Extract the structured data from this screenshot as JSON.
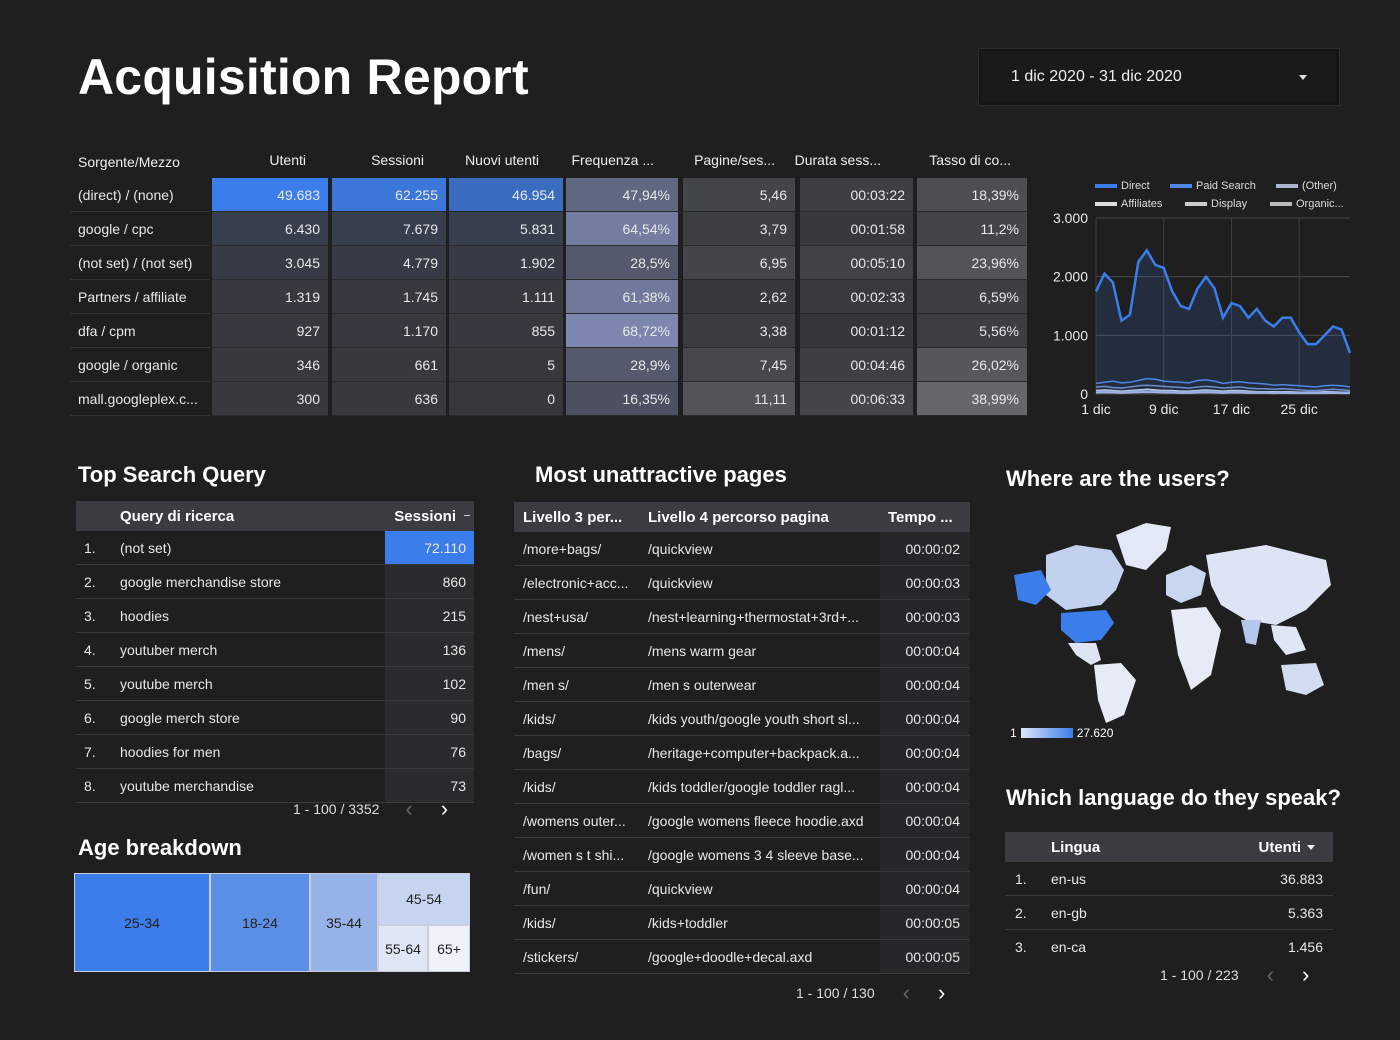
{
  "title": "Acquisition Report",
  "date_range": "1 dic 2020 - 31 dic 2020",
  "colors": {
    "accent": "#3b7dea",
    "background": "#1f1f1f",
    "header_bg": "#3a3c42"
  },
  "main_table": {
    "headers": [
      "Sorgente/Mezzo",
      "Utenti",
      "Sessioni",
      "Nuovi utenti",
      "Frequenza ...",
      "Pagine/ses...",
      "Durata sess...",
      "Tasso di co..."
    ],
    "rows": [
      [
        "(direct) / (none)",
        "49.683",
        "62.255",
        "46.954",
        "47,94%",
        "5,46",
        "00:03:22",
        "18,39%"
      ],
      [
        "google / cpc",
        "6.430",
        "7.679",
        "5.831",
        "64,54%",
        "3,79",
        "00:01:58",
        "11,2%"
      ],
      [
        "(not set) / (not set)",
        "3.045",
        "4.779",
        "1.902",
        "28,5%",
        "6,95",
        "00:05:10",
        "23,96%"
      ],
      [
        "Partners / affiliate",
        "1.319",
        "1.745",
        "1.111",
        "61,38%",
        "2,62",
        "00:02:33",
        "6,59%"
      ],
      [
        "dfa / cpm",
        "927",
        "1.170",
        "855",
        "68,72%",
        "3,38",
        "00:01:12",
        "5,56%"
      ],
      [
        "google / organic",
        "346",
        "661",
        "5",
        "28,9%",
        "7,45",
        "00:04:46",
        "26,02%"
      ],
      [
        "mall.googleplex.c...",
        "300",
        "636",
        "0",
        "16,35%",
        "11,11",
        "00:06:33",
        "38,99%"
      ]
    ],
    "heat": [
      [
        1.0,
        0.9,
        0.75,
        0.45,
        0.3,
        0.2,
        0.45
      ],
      [
        0.1,
        0.1,
        0.1,
        0.7,
        0.2,
        0.1,
        0.3
      ],
      [
        0.05,
        0.05,
        0.05,
        0.3,
        0.3,
        0.25,
        0.55
      ],
      [
        0.02,
        0.02,
        0.02,
        0.65,
        0.1,
        0.12,
        0.2
      ],
      [
        0.02,
        0.02,
        0.02,
        0.8,
        0.15,
        0.05,
        0.18
      ],
      [
        0.01,
        0.01,
        0.0,
        0.3,
        0.35,
        0.22,
        0.6
      ],
      [
        0.01,
        0.01,
        0.0,
        0.2,
        0.55,
        0.3,
        0.85
      ]
    ]
  },
  "chart_data": {
    "type": "line",
    "legend": [
      "Direct",
      "Paid Search",
      "(Other)",
      "Affiliates",
      "Display",
      "Organic..."
    ],
    "x_ticks": [
      "1 dic",
      "9 dic",
      "17 dic",
      "25 dic"
    ],
    "y_ticks": [
      "3.000",
      "2.000",
      "1.000",
      "0"
    ],
    "ylim": [
      0,
      3000
    ],
    "x": [
      1,
      2,
      3,
      4,
      5,
      6,
      7,
      8,
      9,
      10,
      11,
      12,
      13,
      14,
      15,
      16,
      17,
      18,
      19,
      20,
      21,
      22,
      23,
      24,
      25,
      26,
      27,
      28,
      29,
      30,
      31
    ],
    "series": [
      {
        "name": "Direct",
        "color": "#3b7dea",
        "values": [
          1750,
          2050,
          1900,
          1250,
          1350,
          2250,
          2450,
          2200,
          2150,
          1750,
          1500,
          1450,
          1800,
          2000,
          1800,
          1300,
          1550,
          1500,
          1300,
          1450,
          1250,
          1150,
          1300,
          1300,
          1050,
          850,
          850,
          1000,
          1150,
          1100,
          700
        ]
      },
      {
        "name": "Paid Search",
        "color": "#4f86e8",
        "values": [
          180,
          200,
          220,
          190,
          200,
          230,
          260,
          250,
          220,
          210,
          200,
          190,
          230,
          240,
          220,
          180,
          200,
          210,
          190,
          180,
          170,
          150,
          160,
          150,
          140,
          130,
          120,
          140,
          150,
          140,
          120
        ]
      },
      {
        "name": "(Other)",
        "color": "#6f8fd0",
        "values": [
          120,
          130,
          110,
          100,
          120,
          140,
          150,
          140,
          130,
          120,
          110,
          100,
          120,
          130,
          120,
          100,
          110,
          120,
          100,
          90,
          90,
          80,
          90,
          80,
          70,
          60,
          60,
          70,
          80,
          70,
          60
        ]
      },
      {
        "name": "Affiliates",
        "color": "#b8c6e8",
        "values": [
          60,
          70,
          60,
          50,
          60,
          70,
          80,
          70,
          60,
          60,
          50,
          50,
          60,
          70,
          60,
          50,
          60,
          60,
          50,
          40,
          40,
          40,
          40,
          40,
          30,
          30,
          30,
          40,
          40,
          30,
          30
        ]
      },
      {
        "name": "Display",
        "color": "#8fa8dc",
        "values": [
          40,
          50,
          40,
          30,
          40,
          50,
          50,
          50,
          40,
          40,
          30,
          30,
          40,
          50,
          40,
          30,
          40,
          40,
          30,
          30,
          30,
          20,
          30,
          20,
          20,
          20,
          20,
          20,
          30,
          20,
          20
        ]
      },
      {
        "name": "Organic...",
        "color": "#a0b4e0",
        "values": [
          20,
          25,
          20,
          15,
          20,
          25,
          30,
          25,
          20,
          20,
          15,
          15,
          20,
          25,
          20,
          15,
          20,
          20,
          15,
          15,
          15,
          10,
          15,
          10,
          10,
          10,
          10,
          10,
          15,
          10,
          10
        ]
      }
    ]
  },
  "search_query": {
    "title": "Top Search Query",
    "headers": [
      "Query di ricerca",
      "Sessioni"
    ],
    "rows": [
      [
        "1.",
        "(not set)",
        "72.110"
      ],
      [
        "2.",
        "google merchandise store",
        "860"
      ],
      [
        "3.",
        "hoodies",
        "215"
      ],
      [
        "4.",
        "youtuber merch",
        "136"
      ],
      [
        "5.",
        "youtube merch",
        "102"
      ],
      [
        "6.",
        "google merch store",
        "90"
      ],
      [
        "7.",
        "hoodies for men",
        "76"
      ],
      [
        "8.",
        "youtube merchandise",
        "73"
      ]
    ],
    "pager": "1 - 100 / 3352"
  },
  "pages": {
    "title": "Most unattractive pages",
    "headers": [
      "Livello 3 per...",
      "Livello 4 percorso pagina",
      "Tempo ..."
    ],
    "rows": [
      [
        "/more+bags/",
        "/quickview",
        "00:00:02"
      ],
      [
        "/electronic+acc...",
        "/quickview",
        "00:00:03"
      ],
      [
        "/nest+usa/",
        "/nest+learning+thermostat+3rd+...",
        "00:00:03"
      ],
      [
        "/mens/",
        "/mens warm gear",
        "00:00:04"
      ],
      [
        "/men s/",
        "/men s outerwear",
        "00:00:04"
      ],
      [
        "/kids/",
        "/kids youth/google youth short sl...",
        "00:00:04"
      ],
      [
        "/bags/",
        "/heritage+computer+backpack.a...",
        "00:00:04"
      ],
      [
        "/kids/",
        "/kids toddler/google toddler ragl...",
        "00:00:04"
      ],
      [
        "/womens outer...",
        "/google womens fleece hoodie.axd",
        "00:00:04"
      ],
      [
        "/women s t shi...",
        "/google womens 3 4 sleeve base...",
        "00:00:04"
      ],
      [
        "/fun/",
        "/quickview",
        "00:00:04"
      ],
      [
        "/kids/",
        "/kids+toddler",
        "00:00:05"
      ],
      [
        "/stickers/",
        "/google+doodle+decal.axd",
        "00:00:05"
      ]
    ],
    "pager": "1 - 100 / 130"
  },
  "map": {
    "title": "Where are the users?",
    "legend_min": "1",
    "legend_max": "27.620"
  },
  "language": {
    "title": "Which language do they speak?",
    "headers": [
      "Lingua",
      "Utenti"
    ],
    "rows": [
      [
        "1.",
        "en-us",
        "36.883"
      ],
      [
        "2.",
        "en-gb",
        "5.363"
      ],
      [
        "3.",
        "en-ca",
        "1.456"
      ]
    ],
    "pager": "1 - 100 / 223"
  },
  "age": {
    "title": "Age breakdown",
    "segments": [
      "25-34",
      "18-24",
      "35-44",
      "45-54",
      "55-64",
      "65+"
    ]
  }
}
